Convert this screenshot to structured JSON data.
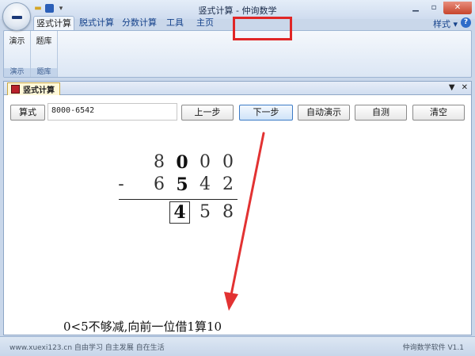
{
  "window": {
    "title": "竖式计算 - 仲询数学"
  },
  "ribbon": {
    "tabs": [
      "竖式计算",
      "脱式计算",
      "分数计算",
      "工具",
      "主页"
    ],
    "style_menu": "样式",
    "groups": [
      {
        "button": "演示",
        "label": "演示"
      },
      {
        "button": "题库",
        "label": "题库"
      }
    ]
  },
  "document": {
    "tab_title": "竖式计算",
    "toolbar": {
      "formula_button": "算式",
      "expression_value": "8000-6542",
      "prev_button": "上一步",
      "next_button": "下一步",
      "auto_demo_button": "自动演示",
      "self_test_button": "自测",
      "clear_button": "清空"
    },
    "calculation": {
      "minuend": [
        "8",
        "0",
        "0",
        "0"
      ],
      "operator": "-",
      "subtrahend": [
        "6",
        "5",
        "4",
        "2"
      ],
      "result": [
        "4",
        "5",
        "8"
      ]
    },
    "hint": "0<5不够减,向前一位借1算10"
  },
  "statusbar": {
    "left": "www.xuexi123.cn 自由学习 自主发展 自在生活",
    "right": "仲询数学软件 V1.1"
  },
  "colors": {
    "highlight": "#e02626",
    "arrow": "#e23232"
  }
}
